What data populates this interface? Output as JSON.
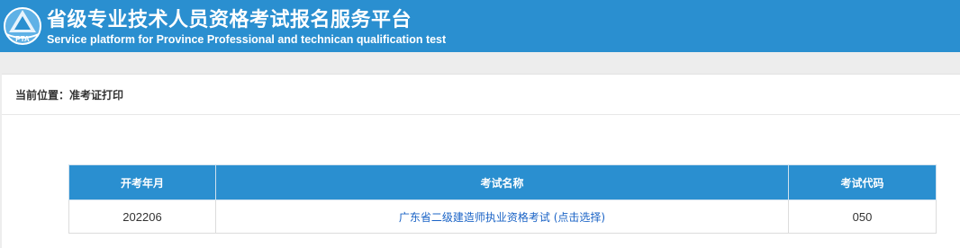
{
  "header": {
    "logo_text": "PTA",
    "title_cn": "省级专业技术人员资格考试报名服务平台",
    "title_en": "Service platform for Province Professional and technican qualification test",
    "bg_color": "#2a8fd0"
  },
  "breadcrumb": {
    "label": "当前位置：",
    "current": "准考证打印"
  },
  "table": {
    "columns": [
      "开考年月",
      "考试名称",
      "考试代码"
    ],
    "rows": [
      {
        "date": "202206",
        "name": "广东省二级建造师执业资格考试 (点击选择)",
        "code": "050"
      }
    ]
  }
}
